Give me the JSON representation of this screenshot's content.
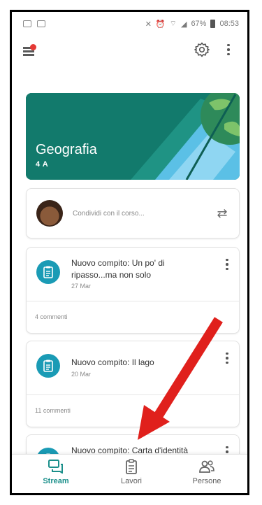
{
  "status_bar": {
    "signal": "67%",
    "time": "08:53"
  },
  "course": {
    "title": "Geografia",
    "section": "4 A"
  },
  "share": {
    "placeholder": "Condividi con il corso..."
  },
  "posts": [
    {
      "title": "Nuovo compito: Un po' di ripasso...ma non solo",
      "date": "27 Mar",
      "comments": "4 commenti"
    },
    {
      "title": "Nuovo compito: Il lago",
      "date": "20 Mar",
      "comments": "11 commenti"
    },
    {
      "title": "Nuovo compito: Carta d'identità",
      "date": "",
      "comments": ""
    }
  ],
  "bottom_nav": {
    "items": [
      {
        "label": "Stream",
        "active": true
      },
      {
        "label": "Lavori",
        "active": false
      },
      {
        "label": "Persone",
        "active": false
      }
    ]
  },
  "colors": {
    "accent": "#1a8f8a",
    "banner": "#127a6c",
    "assignment_icon": "#1a9bb5",
    "arrow": "#e0201c"
  }
}
